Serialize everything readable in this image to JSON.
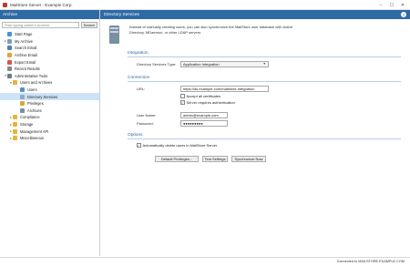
{
  "window": {
    "title": "MailStore Server - Example Corp."
  },
  "sidebar": {
    "header": "Archive",
    "search": {
      "placeholder": "Start typing admin's Archive",
      "button_label": "Search"
    },
    "tree": [
      {
        "label": "Start Page",
        "icon": "home-icon",
        "color": "#4a90d9"
      },
      {
        "label": "My Archive",
        "icon": "archive-icon",
        "color": "#7a9cc6"
      },
      {
        "label": "Search Email",
        "icon": "search-icon",
        "color": "#5b7fa8"
      },
      {
        "label": "Archive Email",
        "icon": "archive-email-icon",
        "color": "#e2a33a"
      },
      {
        "label": "Export Email",
        "icon": "export-icon",
        "color": "#d9534f"
      },
      {
        "label": "Recent Results",
        "icon": "recent-icon",
        "color": "#888888"
      },
      {
        "label": "Administrative Tools",
        "icon": "tools-icon",
        "color": "#6c7a89"
      },
      {
        "label": "Users and Archives",
        "icon": "users-folder-icon",
        "color": "#e8b339"
      },
      {
        "label": "Users",
        "icon": "users-icon",
        "color": "#5a8fc7"
      },
      {
        "label": "Directory Services",
        "icon": "directory-services-icon",
        "color": "#8faac5"
      },
      {
        "label": "Privileges",
        "icon": "privileges-icon",
        "color": "#d4a83a"
      },
      {
        "label": "Archives",
        "icon": "archives-icon",
        "color": "#7b8fa3"
      },
      {
        "label": "Compliance",
        "icon": "folder-icon",
        "color": "#e8b339"
      },
      {
        "label": "Storage",
        "icon": "folder-icon",
        "color": "#e8b339"
      },
      {
        "label": "Management API",
        "icon": "folder-icon",
        "color": "#e8b339"
      },
      {
        "label": "Miscellaneous",
        "icon": "folder-icon",
        "color": "#e8b339"
      }
    ]
  },
  "main": {
    "header": "Directory Services",
    "help_icon": "help-icon",
    "intro": "Instead of manually creating users, you can also synchronize the MailStore user database with Active Directory, MDaemon, or other LDAP servers.",
    "integration": {
      "section_title": "Integration",
      "type_label": "Directory Services Type:",
      "type_value": "Application Integration"
    },
    "connection": {
      "section_title": "Connection",
      "url_label": "URL:",
      "url_value": "https://ds.example.com/mailstore-integration",
      "accept_certs_label": "Accept all certificates",
      "accept_certs_checked": false,
      "server_auth_label": "Server requires authentication",
      "server_auth_checked": true,
      "username_label": "User Name:",
      "username_value": "admin@example.com",
      "password_label": "Password:",
      "password_value": "●●●●●●●●●"
    },
    "options": {
      "section_title": "Options",
      "delete_users_label": "Automatically delete users in MailStore Server",
      "delete_users_checked": true
    },
    "buttons": {
      "default_privileges": "Default Privileges...",
      "test_settings": "Test Settings",
      "synchronize_now": "Synchronize Now"
    }
  },
  "statusbar": {
    "text": "Connected to MAILSTORE.EXAMPLE.COM"
  },
  "colors": {
    "accent": "#2d6aa6",
    "selection": "#cfe3f7"
  }
}
